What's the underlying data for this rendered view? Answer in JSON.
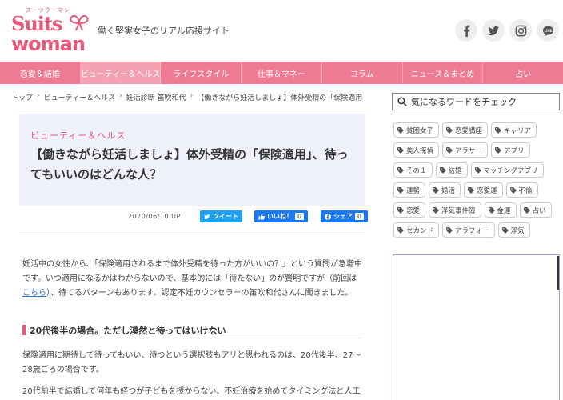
{
  "header": {
    "logo_kana": "スーツウーマン",
    "logo_line1": "Suits",
    "logo_line2": "woman",
    "tagline": "働く堅実女子のリアル応援サイト",
    "social_icons": [
      "facebook-icon",
      "twitter-icon",
      "instagram-icon",
      "line-icon"
    ],
    "line_label": "LINE"
  },
  "nav": {
    "items": [
      {
        "label": "恋愛＆結婚"
      },
      {
        "label": "ビューティー＆ヘルス",
        "active": true
      },
      {
        "label": "ライフスタイル"
      },
      {
        "label": "仕事＆マネー"
      },
      {
        "label": "コラム"
      },
      {
        "label": "ニュース＆まとめ"
      },
      {
        "label": "占い"
      }
    ],
    "color": "#ef7a93",
    "active_color": "#f4a1b2"
  },
  "breadcrumb": [
    "トップ",
    "ビューティー＆ヘルス",
    "妊活診断 笛吹和代",
    "【働きながら妊活しましょ】体外受精の「保険適用」..."
  ],
  "article": {
    "category": "ビューティー＆ヘルス",
    "title": "【働きながら妊活しましょ】体外受精の「保険適用」、待ってもいいのはどんな人？",
    "date": "2020/06/10 UP",
    "share": {
      "tweet": "ツイート",
      "like": "いいね！",
      "like_count": "0",
      "fb_share": "シェア",
      "fb_count": "0"
    },
    "intro_before_link": "妊活中の女性から、「保険適用されるまで体外受精を待った方がいいの？」という質問が急増中です。いつ適用になるかはわからないので、基本的には「待たない」のが賢明ですが（前回は",
    "intro_link": "こちら",
    "intro_after_link": "）、待てるパターンもあります。認定不妊カウンセラーの笛吹和代さんに聞きました。",
    "heading": "20代後半の場合。ただし漠然と待ってはいけない",
    "para2": "保険適用に期待して待ってもいい、待つという選択肢もアリと思われるのは、20代後半、27～28歳ごろの場合です。",
    "para3": "20代前半で結婚して何年も経つが子どもを授からない、不妊治療を始めてタイミング法と人工"
  },
  "sidebar": {
    "search_placeholder": "気になるワードをチェック",
    "tags": [
      "貧困女子",
      "恋愛講座",
      "キャリア",
      "美人探偵",
      "アラサー",
      "アプリ",
      "その１",
      "結婚",
      "マッチングアプリ",
      "運勢",
      "婚活",
      "恋愛運",
      "不倫",
      "恋愛",
      "浮気事件簿",
      "金運",
      "占い",
      "セカンド",
      "アラフォー",
      "浮気"
    ]
  },
  "colors": {
    "brand_pink": "#e8587a",
    "twitter": "#1da1f2",
    "facebook": "#1877f2",
    "link": "#2b6fd1"
  }
}
